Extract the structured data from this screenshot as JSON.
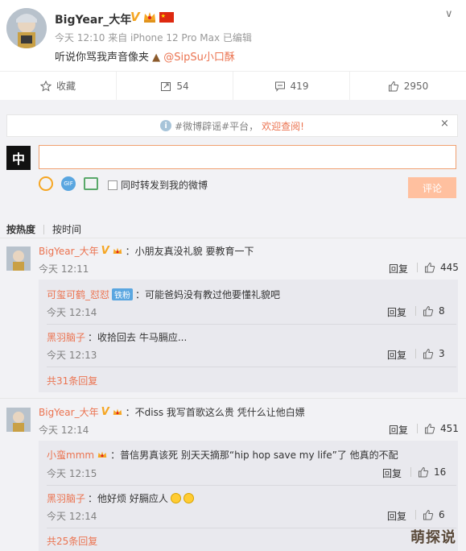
{
  "post": {
    "author": "BigYear_大年",
    "meta": "今天 12:10 来自 iPhone 12 Pro Max   已编辑",
    "text": "听说你骂我声音像夹",
    "mention": "@SipSu小口酥",
    "icons": [
      "verified-v-icon",
      "crown-icon",
      "china-flag-icon",
      "poop-emoji-icon",
      "chevron-down-icon"
    ]
  },
  "actions": {
    "favorite": "收藏",
    "repost": "54",
    "comment": "419",
    "like": "2950"
  },
  "notice": {
    "text_before": "#微博辟谣#平台，",
    "text_highlight": "欢迎查阅!",
    "close": "×"
  },
  "composer": {
    "placeholder": "",
    "repost_label": "同时转发到我的微博",
    "submit_label": "评论"
  },
  "sort": {
    "by_hot": "按热度",
    "by_time": "按时间"
  },
  "comments": [
    {
      "user": "BigYear_大年",
      "text": "：小朋友真没礼貌 要教育一下",
      "time": "今天 12:11",
      "reply_label": "回复",
      "likes": "445",
      "replies": [
        {
          "user": "可玺可鹤_怼怼",
          "badge": "铁粉",
          "text": "：可能爸妈没有教过他要懂礼貌吧",
          "time": "今天 12:14",
          "reply_label": "回复",
          "likes": "8"
        },
        {
          "user": "黑羽脑子",
          "text": "：收拾回去 牛马膈应...",
          "time": "今天 12:13",
          "reply_label": "回复",
          "likes": "3"
        }
      ],
      "more": "共31条回复"
    },
    {
      "user": "BigYear_大年",
      "text": "：不diss 我写首歌这么贵 凭什么让他白嫖",
      "time": "今天 12:14",
      "reply_label": "回复",
      "likes": "451",
      "replies": [
        {
          "user": "小蛮mmm",
          "text": "：普信男真该死 别天天摘那“hip hop save my life”了 他真的不配",
          "time": "今天 12:15",
          "reply_label": "回复",
          "likes": "16"
        },
        {
          "user": "黑羽脑子",
          "text": "：他好烦 好膈应人",
          "time": "今天 12:14",
          "reply_label": "回复",
          "likes": "6"
        }
      ],
      "more": "共25条回复"
    }
  ],
  "watermark": "萌探说",
  "colors": {
    "accent": "#eb7350",
    "verified": "#f5a623",
    "panel": "#f2f2f5"
  }
}
